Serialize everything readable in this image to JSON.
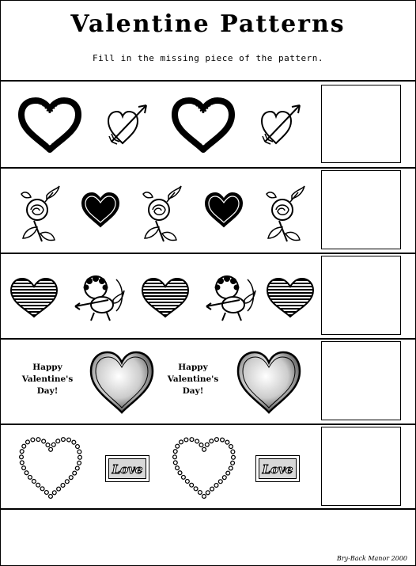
{
  "worksheet": {
    "title": "Valentine Patterns",
    "instructions": "Fill in the missing piece of the pattern.",
    "credit": "Bry-Back Manor 2000"
  },
  "rows": [
    {
      "pattern": [
        "heart-outline-icon",
        "heart-arrow-icon",
        "heart-outline-icon",
        "heart-arrow-icon"
      ]
    },
    {
      "pattern": [
        "rose-icon",
        "heart-solid-icon",
        "rose-icon",
        "heart-solid-icon",
        "rose-icon"
      ]
    },
    {
      "pattern": [
        "heart-striped-icon",
        "cupid-icon",
        "heart-striped-icon",
        "cupid-icon",
        "heart-striped-icon"
      ]
    },
    {
      "pattern": [
        "happy-valentines-text",
        "heart-shaded-icon",
        "happy-valentines-text",
        "heart-shaded-icon"
      ],
      "greeting_lines": [
        "Happy",
        "Valentine's",
        "Day!"
      ]
    },
    {
      "pattern": [
        "heart-beaded-icon",
        "love-tag",
        "heart-beaded-icon",
        "love-tag"
      ],
      "love_label": "Love"
    }
  ]
}
